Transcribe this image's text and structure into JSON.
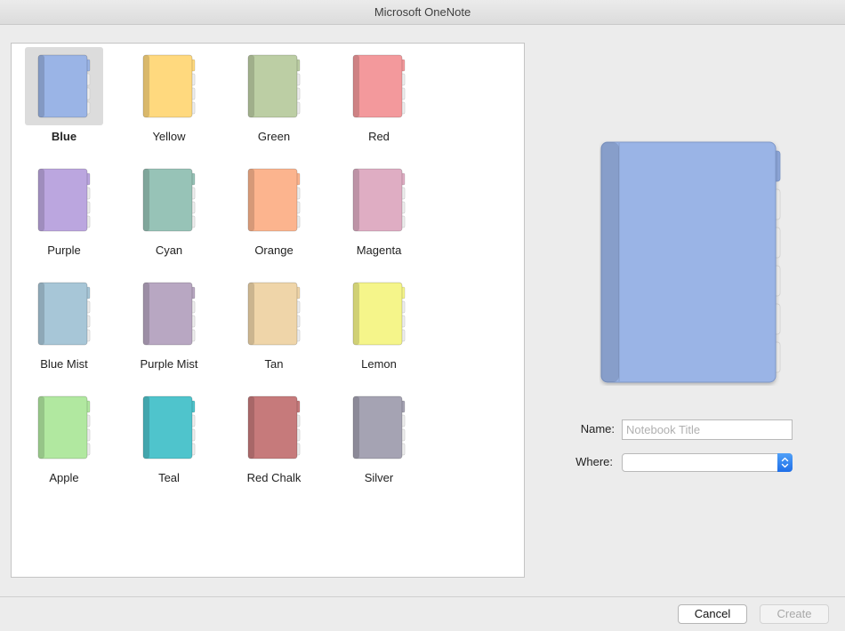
{
  "window": {
    "title": "Microsoft OneNote"
  },
  "colors": [
    {
      "name": "Blue",
      "hex": "#9ab4e6",
      "selected": true
    },
    {
      "name": "Yellow",
      "hex": "#ffd97e"
    },
    {
      "name": "Green",
      "hex": "#bccea4"
    },
    {
      "name": "Red",
      "hex": "#f3999c"
    },
    {
      "name": "Purple",
      "hex": "#bba6df"
    },
    {
      "name": "Cyan",
      "hex": "#97c3b7"
    },
    {
      "name": "Orange",
      "hex": "#fcb48e"
    },
    {
      "name": "Magenta",
      "hex": "#dfadc3"
    },
    {
      "name": "Blue Mist",
      "hex": "#a7c6d7"
    },
    {
      "name": "Purple Mist",
      "hex": "#b8a7c2"
    },
    {
      "name": "Tan",
      "hex": "#efd5a9"
    },
    {
      "name": "Lemon",
      "hex": "#f5f58a"
    },
    {
      "name": "Apple",
      "hex": "#b1e8a0"
    },
    {
      "name": "Teal",
      "hex": "#4fc4cc"
    },
    {
      "name": "Red Chalk",
      "hex": "#c67a7b"
    },
    {
      "name": "Silver",
      "hex": "#a5a3b3"
    }
  ],
  "preview": {
    "color": "#9ab4e6"
  },
  "form": {
    "name_label": "Name:",
    "name_placeholder": "Notebook Title",
    "where_label": "Where:",
    "where_value": ""
  },
  "buttons": {
    "cancel": "Cancel",
    "create": "Create"
  },
  "icons": {
    "where_stepper": "up-down-chevron-icon"
  }
}
